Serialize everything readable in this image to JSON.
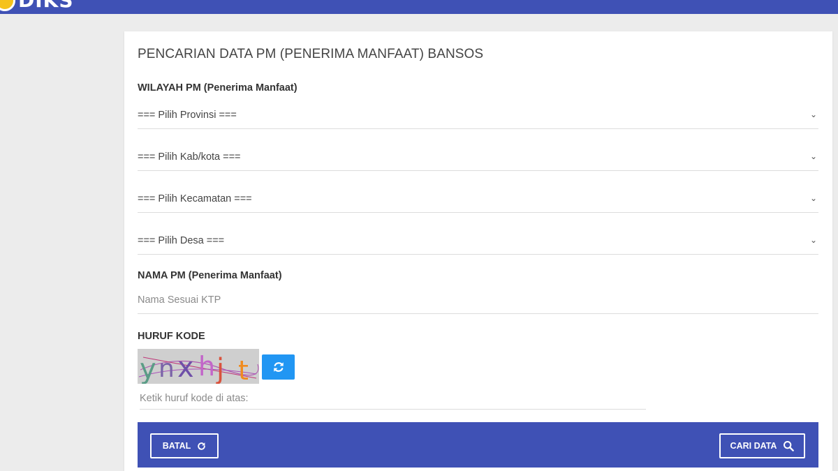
{
  "brand": {
    "logo_text": "DIKS"
  },
  "form": {
    "title": "PENCARIAN DATA PM (PENERIMA MANFAAT) BANSOS",
    "wilayah_label": "WILAYAH PM (Penerima Manfaat)",
    "selects": {
      "provinsi": "=== Pilih Provinsi ===",
      "kabkota": "=== Pilih Kab/kota ===",
      "kecamatan": "=== Pilih Kecamatan ===",
      "desa": "=== Pilih Desa ==="
    },
    "nama_label": "NAMA PM (Penerima Manfaat)",
    "nama_placeholder": "Nama Sesuai KTP",
    "kode_label": "HURUF KODE",
    "captcha_text": "ynxhjt",
    "kode_placeholder": "Ketik huruf kode di atas:"
  },
  "actions": {
    "batal_label": "BATAL",
    "cari_label": "CARI DATA"
  },
  "icons": {
    "chevron": "chevron-down-icon",
    "refresh": "refresh-icon",
    "search": "search-icon"
  },
  "colors": {
    "primary": "#3f51b5",
    "accent": "#2196f3",
    "background": "#ececec"
  }
}
